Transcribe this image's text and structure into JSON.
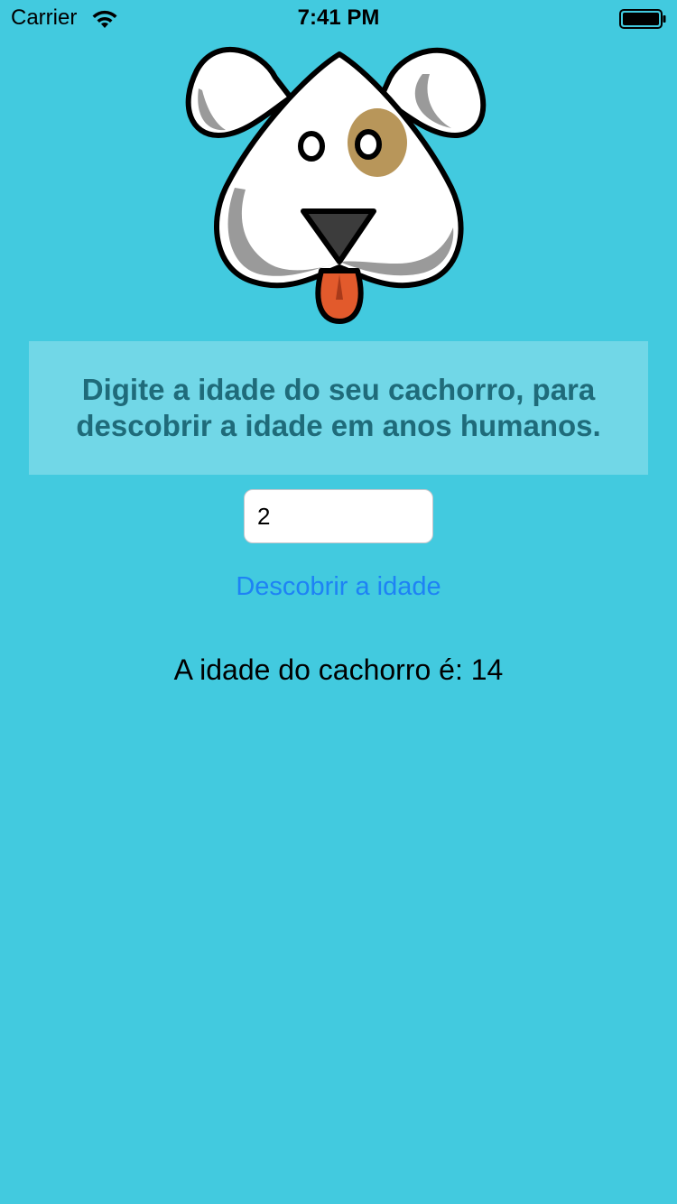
{
  "status_bar": {
    "carrier": "Carrier",
    "time": "7:41 PM",
    "icons": [
      "wifi-icon",
      "battery-icon"
    ]
  },
  "logo": {
    "icon": "dog-face-icon",
    "colors": {
      "outline": "#000000",
      "face": "#ffffff",
      "shade": "#9a9a9a",
      "spot": "#b8965a",
      "nose": "#3c3c3c",
      "tongue": "#e25a2c"
    }
  },
  "instruction": {
    "text": "Digite a idade do seu cachorro, para descobrir a idade em anos humanos."
  },
  "age_input": {
    "value": "2",
    "placeholder": ""
  },
  "discover_button": {
    "label": "Descobrir a idade"
  },
  "result": {
    "text": "A idade do cachorro é: 14"
  },
  "colors": {
    "background": "#42cadf",
    "instruction_text": "#1f6b7a",
    "button_text": "#1e82f5"
  }
}
